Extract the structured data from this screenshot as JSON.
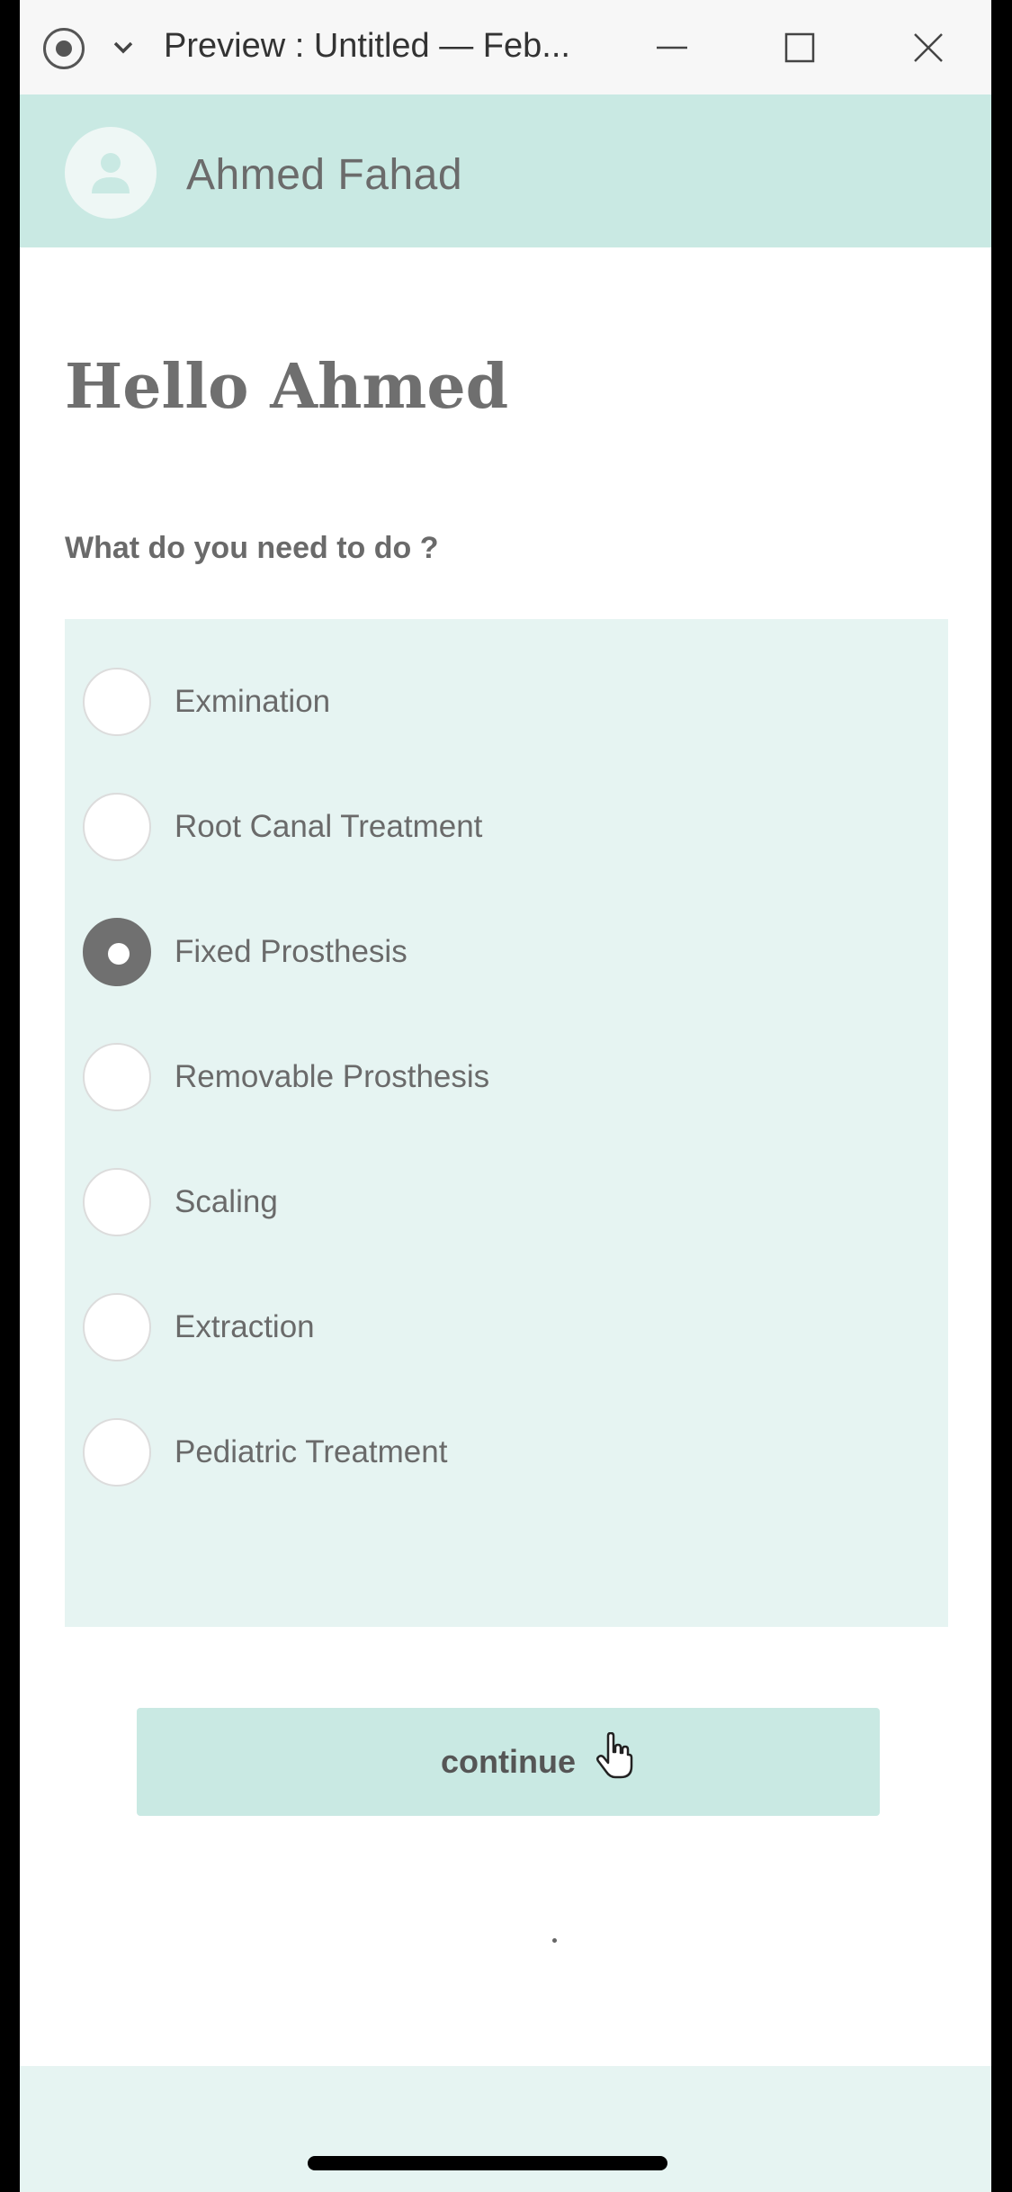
{
  "window": {
    "title": "Preview : Untitled — Feb..."
  },
  "header": {
    "user_name": "Ahmed Fahad"
  },
  "greeting": "Hello Ahmed",
  "question": "What do you need to do ?",
  "options": [
    {
      "label": "Exmination",
      "checked": false
    },
    {
      "label": "Root Canal Treatment",
      "checked": false
    },
    {
      "label": "Fixed Prosthesis",
      "checked": true
    },
    {
      "label": "Removable Prosthesis",
      "checked": false
    },
    {
      "label": "Scaling",
      "checked": false
    },
    {
      "label": "Extraction",
      "checked": false
    },
    {
      "label": "Pediatric Treatment",
      "checked": false
    }
  ],
  "continue_label": "continue",
  "colors": {
    "header_bg": "#c9e9e3",
    "panel_bg": "#e6f4f2",
    "checked_radio": "#707070"
  }
}
